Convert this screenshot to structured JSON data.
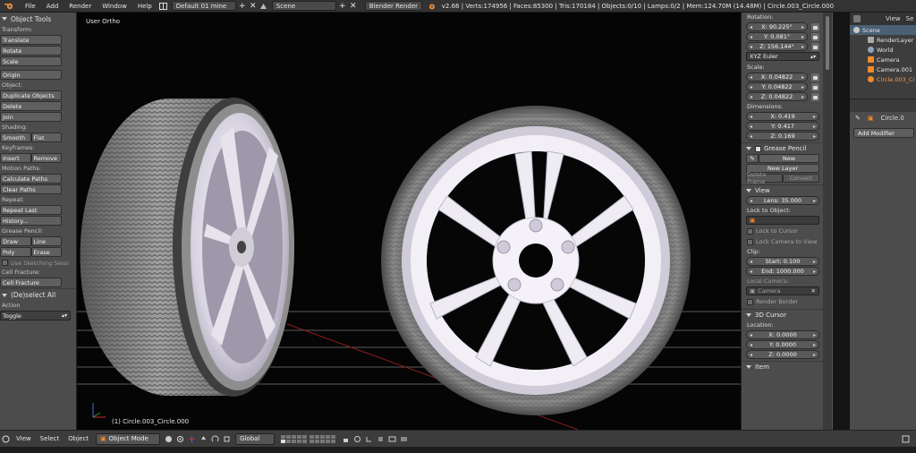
{
  "topbar": {
    "menus": [
      "File",
      "Add",
      "Render",
      "Window",
      "Help"
    ],
    "layout_name": "Default 01 mine",
    "scene_name": "Scene",
    "render_engine": "Blender Render",
    "stats": "v2.66 | Verts:174956 | Faces:85300 | Tris:170184 | Objects:0/10 | Lamps:0/2 | Mem:124.70M (14.48M) | Circle.003_Circle.000"
  },
  "toolshelf": {
    "header": "Object Tools",
    "transform_label": "Transform:",
    "translate": "Translate",
    "rotate": "Rotate",
    "scale": "Scale",
    "origin": "Origin",
    "object_label": "Object:",
    "duplicate": "Duplicate Objects",
    "delete": "Delete",
    "join": "Join",
    "shading_label": "Shading:",
    "smooth": "Smooth",
    "flat": "Flat",
    "keyframes_label": "Keyframes:",
    "insert": "Insert",
    "remove": "Remove",
    "motion_label": "Motion Paths:",
    "calc_paths": "Calculate Paths",
    "clear_paths": "Clear Paths",
    "repeat_label": "Repeat:",
    "repeat_last": "Repeat Last",
    "history": "History...",
    "grease_label": "Grease Pencil:",
    "draw": "Draw",
    "line": "Line",
    "poly": "Poly",
    "erase": "Erase",
    "use_sketching": "Use Sketching Sessi",
    "cell_label": "Cell Fracture:",
    "cell_fracture": "Cell Fracture",
    "deselect_all": "(De)select All",
    "action_label": "Action",
    "action_value": "Toggle"
  },
  "viewport": {
    "title": "User Ortho",
    "object_name": "(1) Circle.003_Circle.000"
  },
  "properties": {
    "rotation_label": "Rotation:",
    "rot_x": "X: 90.225°",
    "rot_y": "Y: 0.081°",
    "rot_z": "Z: 156.144°",
    "rotation_mode": "XYZ Euler",
    "scale_label": "Scale:",
    "scale_x": "X: 0.04822",
    "scale_y": "Y: 0.04822",
    "scale_z": "Z: 0.04822",
    "dimensions_label": "Dimensions:",
    "dim_x": "X: 0.419",
    "dim_y": "Y: 0.417",
    "dim_z": "Z: 0.169",
    "grease_pencil": "Grease Pencil",
    "new": "New",
    "new_layer": "New Layer",
    "delete_frame": "Delete Frame",
    "convert": "Convert",
    "view_section": "View",
    "lens": "Lens: 35.000",
    "lock_to_object": "Lock to Object:",
    "lock_to_cursor": "Lock to Cursor",
    "lock_camera": "Lock Camera to View",
    "clip_label": "Clip:",
    "clip_start": "Start: 0.100",
    "clip_end": "End: 1000.000",
    "local_camera": "Local Camera:",
    "camera": "Camera",
    "render_border": "Render Border",
    "cursor_section": "3D Cursor",
    "location_label": "Location:",
    "cur_x": "X: 0.0000",
    "cur_y": "Y: 0.0000",
    "cur_z": "Z: 0.0000",
    "item_section": "Item"
  },
  "outliner": {
    "view_menu": "View",
    "search_label": "Se",
    "items": [
      "Scene",
      "RenderLayer",
      "World",
      "Camera",
      "Camera.001",
      "Circle.003_Ci"
    ]
  },
  "prop_editor": {
    "object_name": "Circle.0",
    "add_modifier": "Add Modifier"
  },
  "bottombar": {
    "menus": [
      "View",
      "Select",
      "Object"
    ],
    "mode": "Object Mode",
    "orientation": "Global"
  },
  "colors": {
    "accent_orange": "#ff9a4a",
    "selected_row": "#4a6075",
    "panel_bg": "#4c4c4c"
  }
}
